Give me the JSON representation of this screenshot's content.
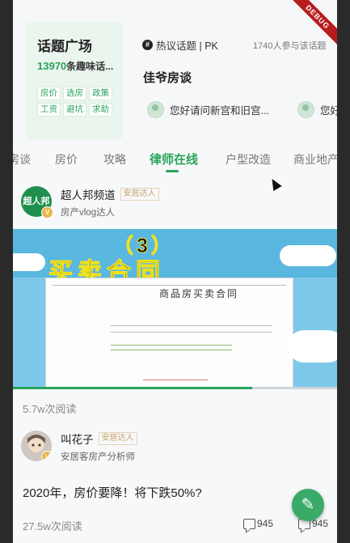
{
  "topic_card": {
    "title": "话题广场",
    "count": "13970",
    "count_suffix": "条趣味话...",
    "tags": [
      "房价",
      "选房",
      "政策",
      "工资",
      "避坑",
      "求助"
    ]
  },
  "hot_topic": {
    "icon": "hash-icon",
    "label": "热议话题 | PK",
    "participants": "1740人参与该话题",
    "name": "佳爷房谈",
    "question": "您好请问新宫和旧宫...",
    "question_next": "您好"
  },
  "tabs": [
    "房谈",
    "房价",
    "攻略",
    "律师在线",
    "户型改造",
    "商业地产"
  ],
  "active_tab": "律师在线",
  "posts": [
    {
      "author": "超人邦频道",
      "avatar_text": "超人邦",
      "badge": "安居达人",
      "subtitle": "房产vlog达人",
      "video_title_1": "（3）",
      "video_title_2": "买卖合同",
      "doc_heading": "商品房买卖合同",
      "reads": "5.7w次阅读"
    },
    {
      "author": "叫花子",
      "badge": "安居达人",
      "subtitle": "安居客房产分析师",
      "text": "2020年，房价要降！将下跌50%?",
      "reads": "27.5w次阅读",
      "comments": "945",
      "comments_2": "945"
    }
  ],
  "debug_banner": "DEBUG",
  "colors": {
    "accent": "#2aa35a",
    "fab": "#3aaa68",
    "debug": "#b71c1c"
  }
}
